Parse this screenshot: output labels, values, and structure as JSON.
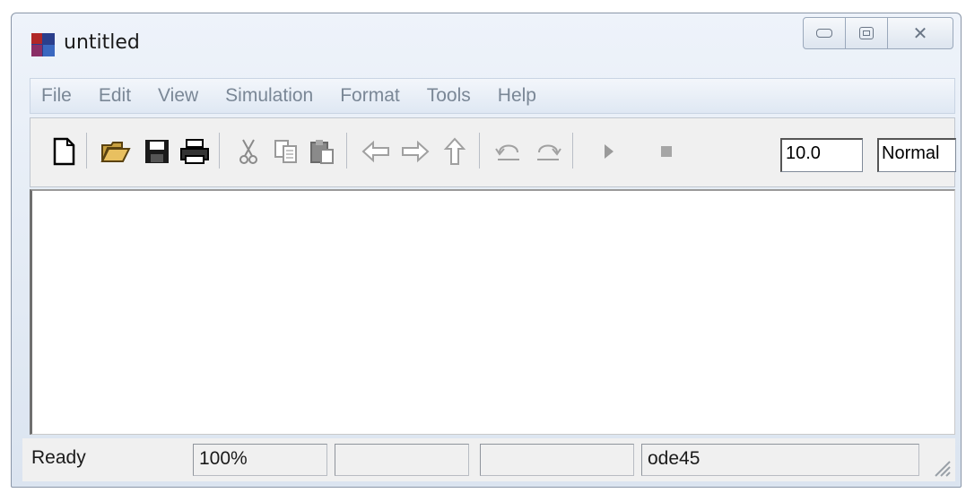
{
  "window": {
    "title": "untitled"
  },
  "menu": [
    "File",
    "Edit",
    "View",
    "Simulation",
    "Format",
    "Tools",
    "Help"
  ],
  "toolbar": {
    "stop_time": "10.0",
    "sim_mode": "Normal",
    "icons": [
      "new-model-icon",
      "open-folder-icon",
      "save-icon",
      "print-icon",
      "cut-icon",
      "copy-icon",
      "paste-icon",
      "back-arrow-icon",
      "forward-arrow-icon",
      "up-arrow-icon",
      "undo-icon",
      "redo-icon",
      "start-simulation-icon",
      "stop-simulation-icon"
    ]
  },
  "status": {
    "state": "Ready",
    "zoom": "100%",
    "solver": "ode45"
  },
  "colors": {
    "titlebar": "#e2eaf4",
    "menu_text": "#7a8796",
    "toolbar_bg": "#f0f0f0"
  }
}
